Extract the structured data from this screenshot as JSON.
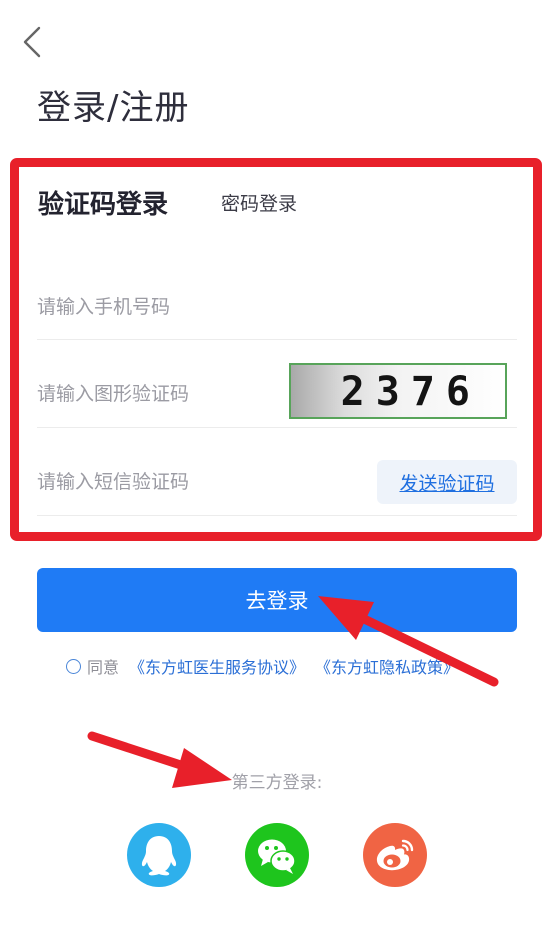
{
  "header": {
    "back_icon": "chevron-left-icon",
    "title": "登录/注册"
  },
  "tabs": {
    "active": "验证码登录",
    "inactive": "密码登录"
  },
  "form": {
    "phone_placeholder": "请输入手机号码",
    "captcha_placeholder": "请输入图形验证码",
    "captcha_code": "2376",
    "sms_placeholder": "请输入短信验证码",
    "send_code_label": "发送验证码"
  },
  "login_button": "去登录",
  "agreement": {
    "checked": false,
    "prefix": "同意",
    "service_link": "《东方虹医生服务协议》",
    "privacy_link": "《东方虹隐私政策》"
  },
  "third_party": {
    "title": "第三方登录:",
    "providers": [
      "qq-icon",
      "wechat-icon",
      "weibo-icon"
    ]
  },
  "colors": {
    "primary": "#1f7bf5",
    "link": "#2b6fd6",
    "highlight_border": "#e8202a",
    "annotation_arrow": "#e8202a",
    "qq": "#2eb0ec",
    "wechat": "#1ec51d",
    "weibo": "#f06444"
  }
}
